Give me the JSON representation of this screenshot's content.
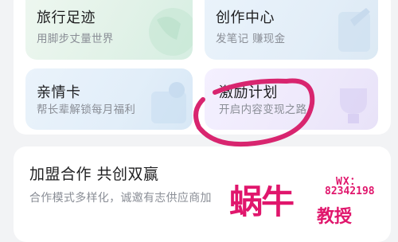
{
  "grid": {
    "cards": [
      {
        "title": "旅行足迹",
        "subtitle": "用脚步丈量世界"
      },
      {
        "title": "创作中心",
        "subtitle": "发笔记 赚现金"
      },
      {
        "title": "亲情卡",
        "subtitle": "帮长辈解锁每月福利"
      },
      {
        "title": "激励计划",
        "subtitle": "开启内容变现之路"
      }
    ]
  },
  "partnership": {
    "title": "加盟合作 共创双赢",
    "subtitle": "合作模式多样化，诚邀有志供应商加"
  },
  "watermark": {
    "wx_label": "WX：",
    "wx_number": "82342198",
    "brand_big": "蜗牛",
    "brand_small": "教授"
  },
  "colors": {
    "accent_scribble": "#d8256f",
    "watermark": "#e0166c"
  }
}
